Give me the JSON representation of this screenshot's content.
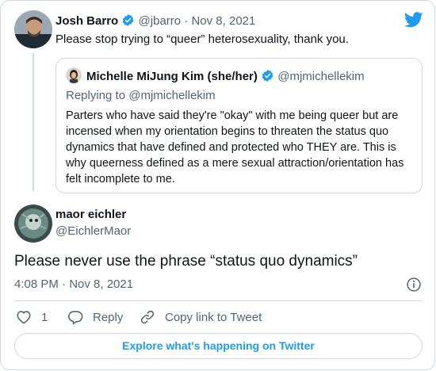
{
  "parent_tweet": {
    "author_name": "Josh Barro",
    "handle_and_date": "@jbarro · Nov 8, 2021",
    "text": "Please stop trying to “queer” heterosexuality, thank you."
  },
  "quoted_tweet": {
    "author_name": "Michelle MiJung Kim (she/her)",
    "handle": "@mjmichellekim",
    "replying_to_prefix": "Replying to ",
    "replying_to_handle": "@mjmichellekim",
    "text": "Parters who have said they're \"okay\" with me being queer but are incensed when my orientation begins to threaten the status quo dynamics that have defined and protected who THEY are. This is why queerness defined as a mere sexual attraction/orientation has felt incomplete to me."
  },
  "main_tweet": {
    "author_name": "maor eichler",
    "handle": "@EichlerMaor",
    "text": "Please never use the phrase “status quo dynamics”",
    "timestamp": "4:08 PM · Nov 8, 2021",
    "like_count": "1",
    "reply_label": "Reply",
    "copy_link_label": "Copy link to Tweet"
  },
  "explore_label": "Explore what's happening on Twitter",
  "colors": {
    "accent": "#1d9bf0",
    "muted": "#536471",
    "border": "#cfd9de",
    "text": "#0f1419"
  },
  "icons": [
    "twitter-bird-icon",
    "verified-badge-icon",
    "info-icon",
    "heart-icon",
    "reply-icon",
    "link-icon"
  ]
}
